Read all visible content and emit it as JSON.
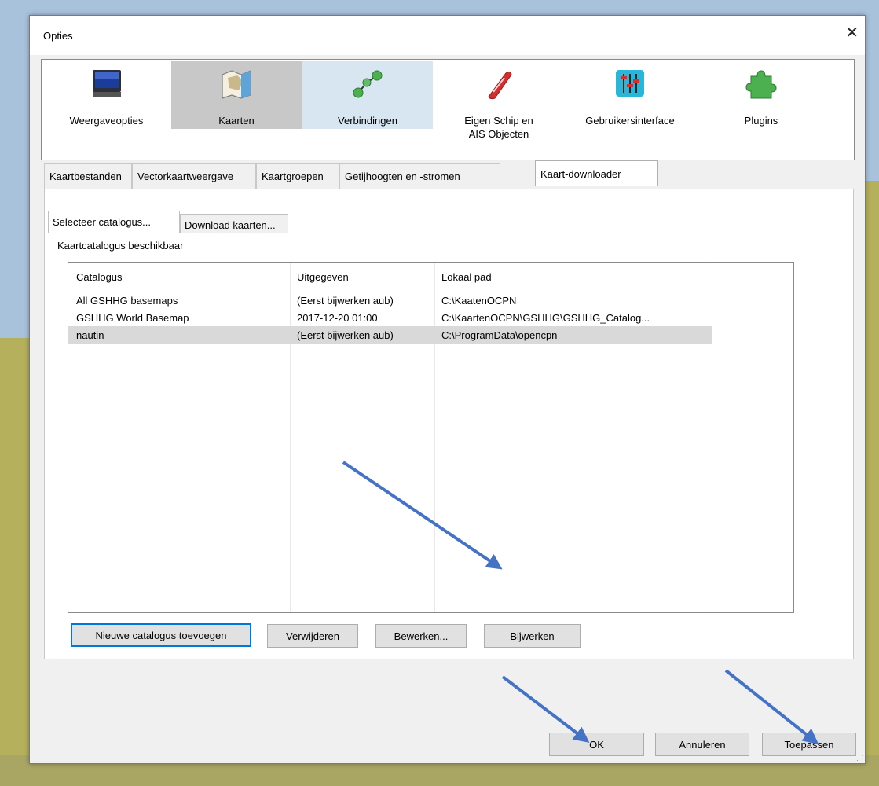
{
  "window": {
    "title": "Opties",
    "close_glyph": "✕"
  },
  "toolbar": {
    "items": [
      {
        "label": "Weergaveopties",
        "icon": "monitor-icon"
      },
      {
        "label": "Kaarten",
        "icon": "chart-map-icon"
      },
      {
        "label": "Verbindingen",
        "icon": "connections-icon"
      },
      {
        "label": "Eigen Schip en",
        "label2": "AIS Objecten",
        "icon": "ship-icon"
      },
      {
        "label": "Gebruikersinterface",
        "icon": "sliders-icon"
      },
      {
        "label": "Plugins",
        "icon": "puzzle-icon"
      }
    ]
  },
  "tabs": [
    {
      "label": "Kaartbestanden"
    },
    {
      "label": "Vectorkaartweergave"
    },
    {
      "label": "Kaartgroepen"
    },
    {
      "label": "Getijhoogten en -stromen"
    },
    {
      "label": "Kaart-downloader"
    }
  ],
  "subtabs": [
    {
      "label": "Selecteer catalogus..."
    },
    {
      "label": "Download kaarten..."
    }
  ],
  "catalog": {
    "group_label": "Kaartcatalogus beschikbaar",
    "columns": [
      "Catalogus",
      "Uitgegeven",
      "Lokaal pad"
    ],
    "rows": [
      {
        "name": "All GSHHG basemaps",
        "published": "(Eerst bijwerken aub)",
        "path": "C:\\KaatenOCPN"
      },
      {
        "name": "GSHHG World Basemap",
        "published": "2017-12-20 01:00",
        "path": "C:\\KaartenOCPN\\GSHHG\\GSHHG_Catalog..."
      },
      {
        "name": "nautin",
        "published": "(Eerst bijwerken aub)",
        "path": "C:\\ProgramData\\opencpn"
      }
    ],
    "selected_row": 2
  },
  "buttons": {
    "add": "Nieuwe catalogus toevoegen",
    "remove": "Verwijderen",
    "edit": "Bewerken...",
    "update": "Bijwerken",
    "ok": "OK",
    "cancel": "Annuleren",
    "apply": "Toepassen"
  },
  "colors": {
    "arrow": "#4472c4",
    "focus": "#0078d7",
    "selected_row": "#d9d9d9",
    "selected_toolbar": "#c8c8c8"
  }
}
